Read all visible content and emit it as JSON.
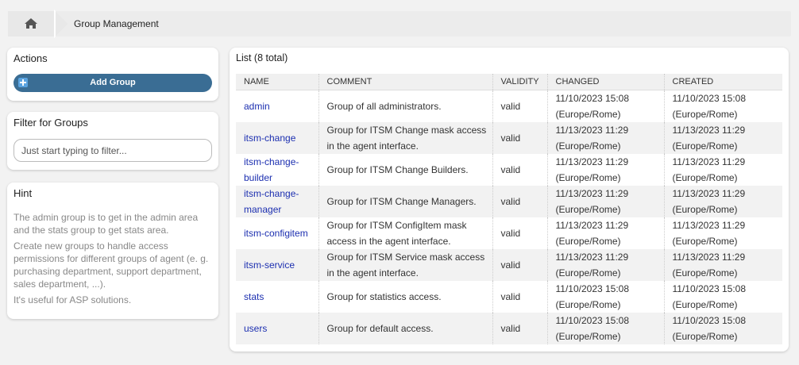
{
  "breadcrumb": {
    "home_icon": "home-icon",
    "current": "Group Management"
  },
  "actions": {
    "title": "Actions",
    "add_group_label": "Add Group",
    "add_icon": "plus-square-icon"
  },
  "filter": {
    "title": "Filter for Groups",
    "placeholder": "Just start typing to filter..."
  },
  "hint": {
    "title": "Hint",
    "paragraphs": [
      "The admin group is to get in the admin area and the stats group to get stats area.",
      "Create new groups to handle access permissions for different groups of agent (e. g. purchasing department, support department, sales department, ...).",
      "It's useful for ASP solutions."
    ]
  },
  "list": {
    "title": "List (8 total)",
    "columns": [
      "NAME",
      "COMMENT",
      "VALIDITY",
      "CHANGED",
      "CREATED"
    ],
    "rows": [
      {
        "name": "admin",
        "comment": "Group of all administrators.",
        "validity": "valid",
        "changed": "11/10/2023 15:08 (Europe/Rome)",
        "created": "11/10/2023 15:08 (Europe/Rome)"
      },
      {
        "name": "itsm-change",
        "comment": "Group for ITSM Change mask access in the agent interface.",
        "validity": "valid",
        "changed": "11/13/2023 11:29 (Europe/Rome)",
        "created": "11/13/2023 11:29 (Europe/Rome)"
      },
      {
        "name": "itsm-change-builder",
        "comment": "Group for ITSM Change Builders.",
        "validity": "valid",
        "changed": "11/13/2023 11:29 (Europe/Rome)",
        "created": "11/13/2023 11:29 (Europe/Rome)"
      },
      {
        "name": "itsm-change-manager",
        "comment": "Group for ITSM Change Managers.",
        "validity": "valid",
        "changed": "11/13/2023 11:29 (Europe/Rome)",
        "created": "11/13/2023 11:29 (Europe/Rome)"
      },
      {
        "name": "itsm-configitem",
        "comment": "Group for ITSM ConfigItem mask access in the agent interface.",
        "validity": "valid",
        "changed": "11/13/2023 11:29 (Europe/Rome)",
        "created": "11/13/2023 11:29 (Europe/Rome)"
      },
      {
        "name": "itsm-service",
        "comment": "Group for ITSM Service mask access in the agent interface.",
        "validity": "valid",
        "changed": "11/13/2023 11:29 (Europe/Rome)",
        "created": "11/13/2023 11:29 (Europe/Rome)"
      },
      {
        "name": "stats",
        "comment": "Group for statistics access.",
        "validity": "valid",
        "changed": "11/10/2023 15:08 (Europe/Rome)",
        "created": "11/10/2023 15:08 (Europe/Rome)"
      },
      {
        "name": "users",
        "comment": "Group for default access.",
        "validity": "valid",
        "changed": "11/10/2023 15:08 (Europe/Rome)",
        "created": "11/10/2023 15:08 (Europe/Rome)"
      }
    ]
  }
}
